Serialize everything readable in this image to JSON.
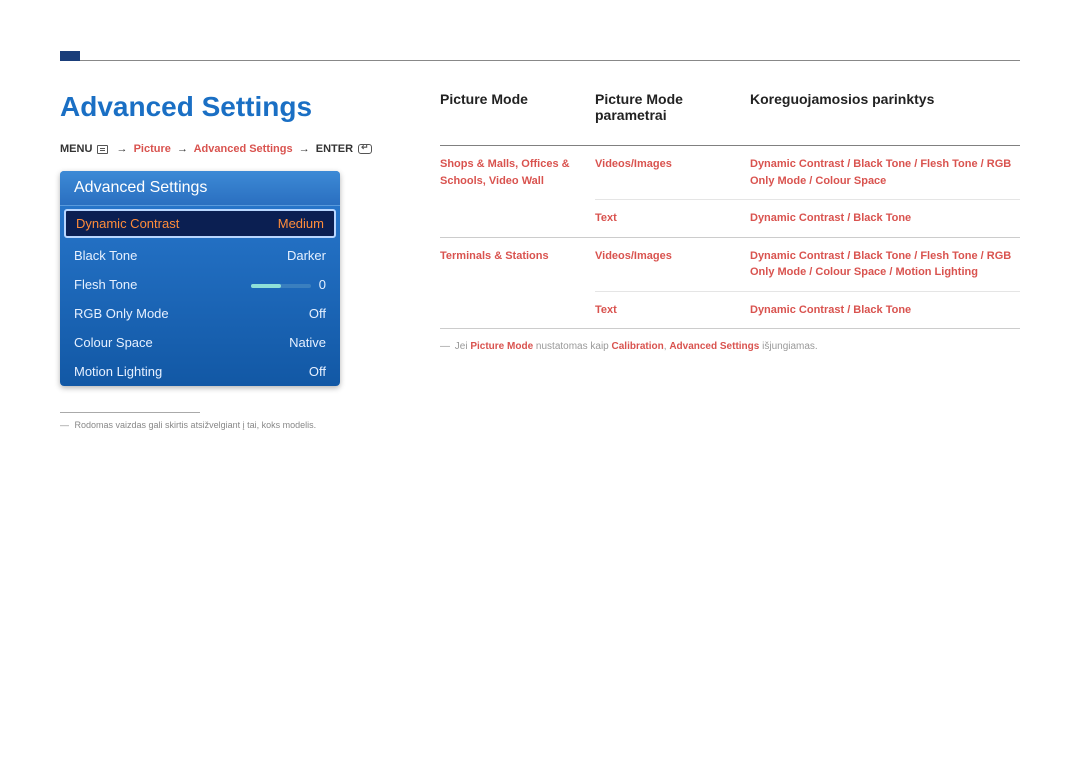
{
  "title": "Advanced Settings",
  "breadcrumb": {
    "menu": "MENU",
    "arrow": "→",
    "picture": "Picture",
    "adv": "Advanced Settings",
    "enter": "ENTER"
  },
  "osd": {
    "header": "Advanced Settings",
    "rows": [
      {
        "label": "Dynamic Contrast",
        "value": "Medium",
        "selected": true,
        "slider": false
      },
      {
        "label": "Black Tone",
        "value": "Darker",
        "selected": false,
        "slider": false
      },
      {
        "label": "Flesh Tone",
        "value": "0",
        "selected": false,
        "slider": true
      },
      {
        "label": "RGB Only Mode",
        "value": "Off",
        "selected": false,
        "slider": false
      },
      {
        "label": "Colour Space",
        "value": "Native",
        "selected": false,
        "slider": false
      },
      {
        "label": "Motion Lighting",
        "value": "Off",
        "selected": false,
        "slider": false
      }
    ]
  },
  "footnote": {
    "dash": "―",
    "text": "Rodomas vaizdas gali skirtis atsižvelgiant į tai, koks modelis."
  },
  "table": {
    "headers": {
      "c1": "Picture Mode",
      "c2": "Picture Mode parametrai",
      "c3": "Koreguojamosios parinktys"
    },
    "groups": [
      {
        "mode": "Shops & Malls, Offices & Schools, Video Wall",
        "items": [
          {
            "param": "Videos/Images",
            "opts": "Dynamic Contrast / Black Tone / Flesh Tone / RGB Only Mode / Colour Space"
          },
          {
            "param": "Text",
            "opts": "Dynamic Contrast / Black Tone"
          }
        ]
      },
      {
        "mode": "Terminals & Stations",
        "items": [
          {
            "param": "Videos/Images",
            "opts": "Dynamic Contrast / Black Tone / Flesh Tone / RGB Only Mode / Colour Space / Motion Lighting"
          },
          {
            "param": "Text",
            "opts": "Dynamic Contrast / Black Tone"
          }
        ]
      }
    ],
    "note": {
      "dash": "―",
      "t1": "Jei ",
      "b1": "Picture Mode",
      "t2": " nustatomas kaip ",
      "b2": "Calibration",
      "t3": ", ",
      "b3": "Advanced Settings",
      "t4": " išjungiamas."
    }
  }
}
